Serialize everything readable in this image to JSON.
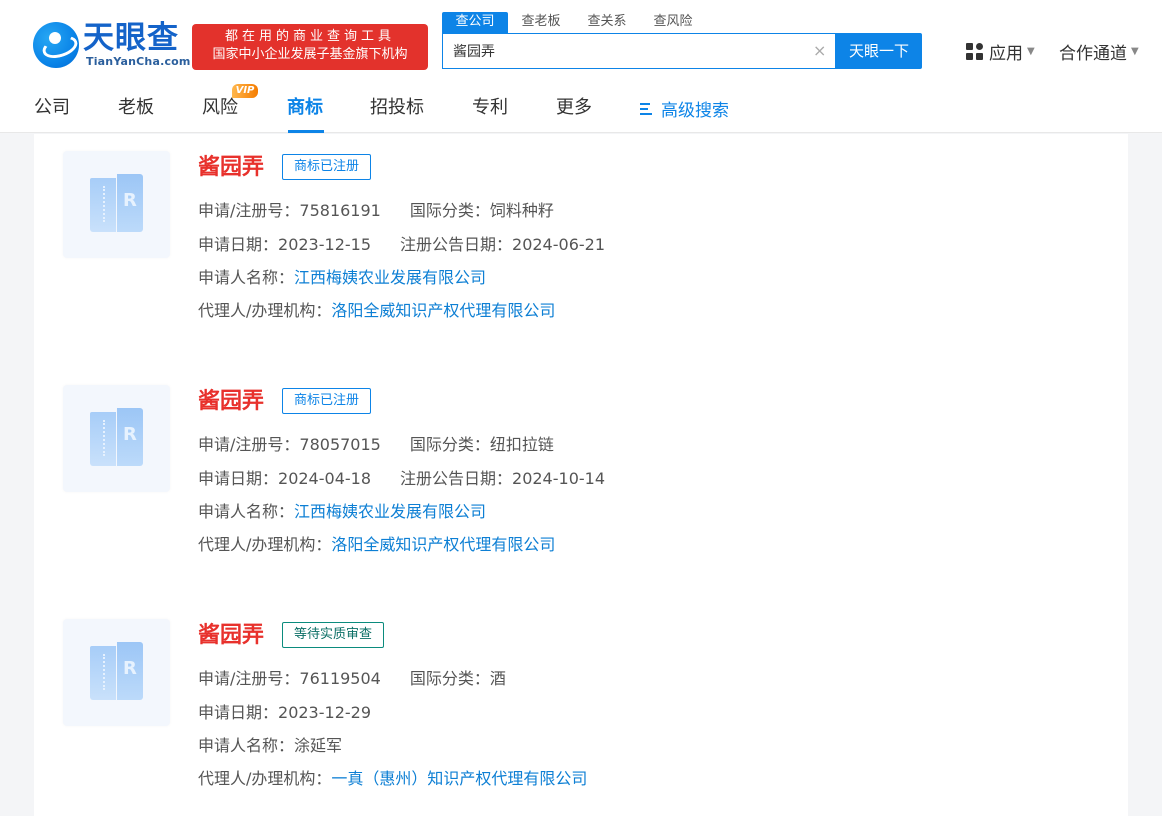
{
  "header": {
    "logo": {
      "cn": "天眼查",
      "en": "TianYanCha.com"
    },
    "ad": {
      "line1": "都在用的商业查询工具",
      "line2": "国家中小企业发展子基金旗下机构"
    },
    "search": {
      "tabs": [
        {
          "label": "查公司"
        },
        {
          "label": "查老板"
        },
        {
          "label": "查关系"
        },
        {
          "label": "查风险"
        }
      ],
      "value": "酱园弄",
      "clear": "×",
      "button": "天眼一下"
    },
    "app_label": "应用",
    "channel_label": "合作通道"
  },
  "nav": {
    "items": [
      {
        "label": "公司"
      },
      {
        "label": "老板"
      },
      {
        "label": "风险"
      },
      {
        "label": "商标"
      },
      {
        "label": "招投标"
      },
      {
        "label": "专利"
      },
      {
        "label": "更多"
      }
    ],
    "vip": "VIP",
    "advanced": "高级搜索"
  },
  "labels": {
    "reg_no": "申请/注册号：",
    "intl_class": "国际分类：",
    "apply_date": "申请日期：",
    "announce_date": "注册公告日期：",
    "applicant": "申请人名称：",
    "agent": "代理人/办理机构："
  },
  "results": [
    {
      "name": "酱园弄",
      "status": "商标已注册",
      "reg_no": "75816191",
      "intl_class": "饲料种籽",
      "apply_date": "2023-12-15",
      "announce_date": "2024-06-21",
      "applicant": "江西梅姨农业发展有限公司",
      "agent": "洛阳全威知识产权代理有限公司"
    },
    {
      "name": "酱园弄",
      "status": "商标已注册",
      "reg_no": "78057015",
      "intl_class": "纽扣拉链",
      "apply_date": "2024-04-18",
      "announce_date": "2024-10-14",
      "applicant": "江西梅姨农业发展有限公司",
      "agent": "洛阳全威知识产权代理有限公司"
    },
    {
      "name": "酱园弄",
      "status": "等待实质审查",
      "reg_no": "76119504",
      "intl_class": "酒",
      "apply_date": "2023-12-29",
      "applicant": "涂延军",
      "agent": "一真（惠州）知识产权代理有限公司"
    }
  ],
  "colors": {
    "accent": "#0d84e7",
    "brand_red": "#e8312c",
    "link": "#0d7fd4"
  }
}
